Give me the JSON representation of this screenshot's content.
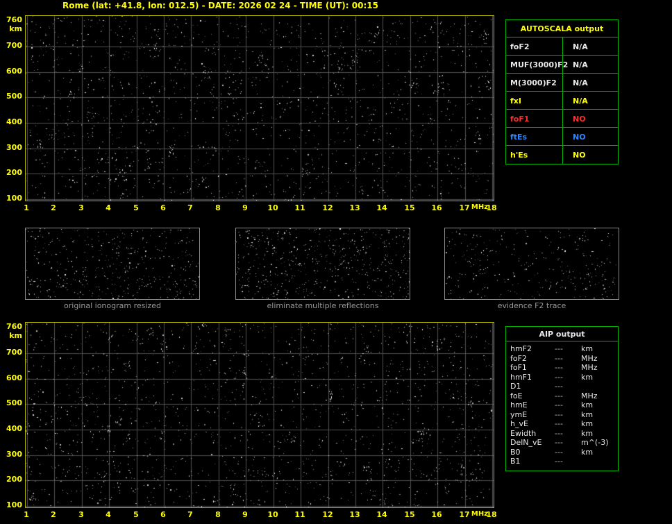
{
  "title": "Rome (lat: +41.8, lon: 012.5) - DATE: 2026 02 24 - TIME (UT): 00:15",
  "colors": {
    "background": "#000000",
    "title_text": "#ffff00",
    "axis_text": "#ffff00",
    "plot_border": "#b2b200",
    "grid_line": "#525252",
    "table_border": "#00b400",
    "autoscala_header_text": "#ffff00",
    "aip_header_text": "#e8e8e8",
    "caption_text": "#9a9a9a",
    "value_white": "#e8e8e8",
    "value_yellow": "#ffff00",
    "value_red": "#ff2a2a",
    "value_blue": "#2e86ff"
  },
  "ionogram_axes": {
    "y_unit": "km",
    "y_max_label": "760",
    "y_ticks": [
      "700",
      "600",
      "500",
      "400",
      "300",
      "200",
      "100"
    ],
    "x_ticks": [
      "1",
      "2",
      "3",
      "4",
      "5",
      "6",
      "7",
      "8",
      "9",
      "10",
      "11",
      "12",
      "13",
      "14",
      "15",
      "16",
      "17",
      "18"
    ],
    "x_unit": "MHz"
  },
  "chart_data": [
    {
      "type": "scatter",
      "name": "main-ionogram",
      "title": "Rome ionogram 2026-02-24 00:15 UT (AUTOSCALA scaling panel)",
      "xlabel": "MHz",
      "ylabel": "km",
      "xlim": [
        1,
        18
      ],
      "ylim": [
        100,
        760
      ],
      "x_ticks": [
        1,
        2,
        3,
        4,
        5,
        6,
        7,
        8,
        9,
        10,
        11,
        12,
        13,
        14,
        15,
        16,
        17,
        18
      ],
      "y_ticks": [
        100,
        200,
        300,
        400,
        500,
        600,
        700,
        760
      ],
      "grid": true,
      "series": [],
      "note": "Only background noise speckle is visible; no ionospheric echo traces were detected (all scaled outputs N/A / NO)."
    },
    {
      "type": "scatter",
      "name": "aip-ionogram",
      "title": "Rome ionogram 2026-02-24 00:15 UT (AIP profile panel)",
      "xlabel": "MHz",
      "ylabel": "km",
      "xlim": [
        1,
        18
      ],
      "ylim": [
        100,
        760
      ],
      "x_ticks": [
        1,
        2,
        3,
        4,
        5,
        6,
        7,
        8,
        9,
        10,
        11,
        12,
        13,
        14,
        15,
        16,
        17,
        18
      ],
      "y_ticks": [
        100,
        200,
        300,
        400,
        500,
        600,
        700,
        760
      ],
      "grid": true,
      "series": [],
      "note": "Only background noise speckle is visible; no profile trace drawn (all AIP outputs ---)."
    }
  ],
  "autoscala": {
    "title": "AUTOSCALA output",
    "rows": [
      {
        "label": "foF2",
        "value": "N/A",
        "color": "#e8e8e8"
      },
      {
        "label": "MUF(3000)F2",
        "value": "N/A",
        "color": "#e8e8e8"
      },
      {
        "label": "M(3000)F2",
        "value": "N/A",
        "color": "#e8e8e8"
      },
      {
        "label": "fxI",
        "value": "N/A",
        "color": "#ffff00"
      },
      {
        "label": "foF1",
        "value": "NO",
        "color": "#ff2a2a"
      },
      {
        "label": "ftEs",
        "value": "NO",
        "color": "#2e86ff"
      },
      {
        "label": "h'Es",
        "value": "NO",
        "color": "#ffff00"
      }
    ]
  },
  "thumbnails": [
    {
      "caption": "original ionogram resized"
    },
    {
      "caption": "eliminate multiple reflections"
    },
    {
      "caption": "evidence F2 trace"
    }
  ],
  "aip": {
    "title": "AIP output",
    "rows": [
      {
        "label": "hmF2",
        "value": "---",
        "unit": "km"
      },
      {
        "label": "foF2",
        "value": "---",
        "unit": "MHz"
      },
      {
        "label": "foF1",
        "value": "---",
        "unit": "MHz"
      },
      {
        "label": "hmF1",
        "value": "---",
        "unit": "km"
      },
      {
        "label": "D1",
        "value": "---",
        "unit": ""
      },
      {
        "label": "foE",
        "value": "---",
        "unit": "MHz"
      },
      {
        "label": "hmE",
        "value": "---",
        "unit": "km"
      },
      {
        "label": "ymE",
        "value": "---",
        "unit": "km"
      },
      {
        "label": "h_vE",
        "value": "---",
        "unit": "km"
      },
      {
        "label": "Ewidth",
        "value": "---",
        "unit": "km"
      },
      {
        "label": "DelN_vE",
        "value": "---",
        "unit": "m^(-3)"
      },
      {
        "label": "B0",
        "value": "---",
        "unit": "km"
      },
      {
        "label": "B1",
        "value": "---",
        "unit": ""
      }
    ]
  }
}
